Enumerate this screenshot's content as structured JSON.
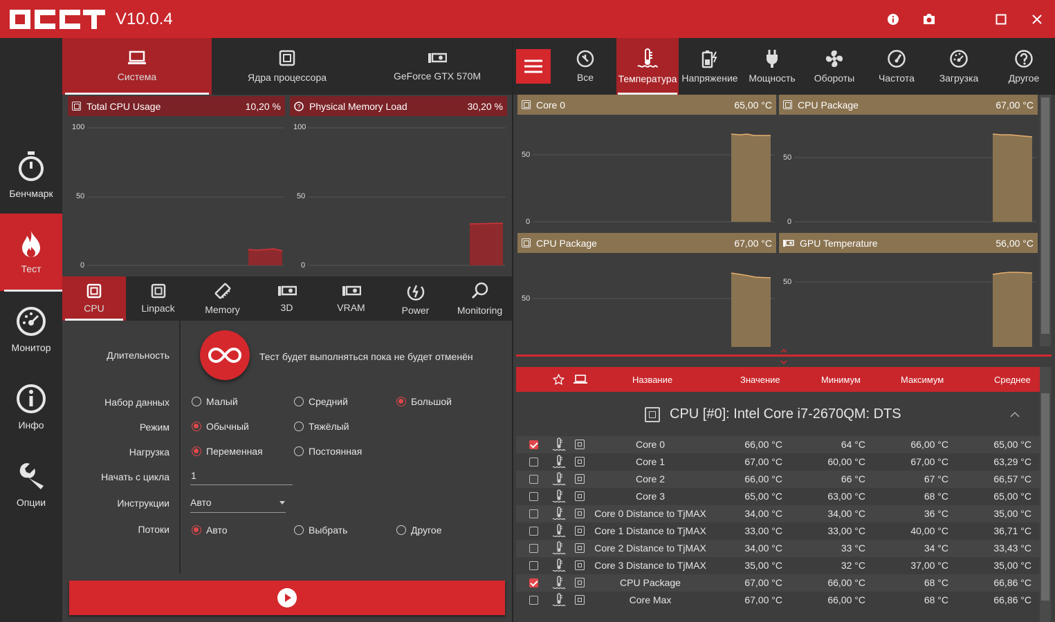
{
  "app": {
    "title": "OCCT",
    "version": "V10.0.4"
  },
  "window_buttons": {
    "info": "info-icon",
    "screenshot": "camera-icon",
    "maximize": "maximize-icon",
    "close": "close-icon"
  },
  "colors": {
    "accent": "#c8262b",
    "dark": "#2a2a2a",
    "panel": "#3d3d3d",
    "tan": "#8a7350"
  },
  "leftnav": [
    {
      "label": "Бенчмарк",
      "icon": "stopwatch-icon"
    },
    {
      "label": "Тест",
      "icon": "flame-icon"
    },
    {
      "label": "Монитор",
      "icon": "gauge-icon"
    },
    {
      "label": "Инфо",
      "icon": "info-icon"
    },
    {
      "label": "Опции",
      "icon": "wrench-icon"
    }
  ],
  "system_tabs": [
    {
      "label": "Система",
      "icon": "laptop-icon"
    },
    {
      "label": "Ядра процессора",
      "icon": "cpu-icon"
    },
    {
      "label": "GeForce GTX 570M",
      "icon": "gpu-icon"
    }
  ],
  "left_graphs": [
    {
      "title": "Total CPU Usage",
      "value": "10,20 %",
      "ticks": [
        "100",
        "50",
        "0"
      ]
    },
    {
      "title": "Physical Memory Load",
      "value": "30,20 %",
      "ticks": [
        "100",
        "50",
        "0"
      ]
    }
  ],
  "test_tabs": [
    {
      "label": "CPU",
      "icon": "cpu-icon"
    },
    {
      "label": "Linpack",
      "icon": "cpu-icon"
    },
    {
      "label": "Memory",
      "icon": "memory-icon"
    },
    {
      "label": "3D",
      "icon": "gpu-icon"
    },
    {
      "label": "VRAM",
      "icon": "gpu-icon"
    },
    {
      "label": "Power",
      "icon": "power-icon"
    },
    {
      "label": "Monitoring",
      "icon": "magnifier-icon"
    }
  ],
  "settings": {
    "duration_label": "Длительность",
    "duration_text": "Тест будет выполняться пока не будет отменён",
    "dataset_label": "Набор данных",
    "dataset_options": [
      "Малый",
      "Средний",
      "Большой"
    ],
    "mode_label": "Режим",
    "mode_options": [
      "Обычный",
      "Тяжёлый"
    ],
    "load_label": "Нагрузка",
    "load_options": [
      "Переменная",
      "Постоянная"
    ],
    "start_cycle_label": "Начать с цикла",
    "start_cycle_value": "1",
    "instructions_label": "Инструкции",
    "instructions_value": "Авто",
    "threads_label": "Потоки",
    "threads_options": [
      "Авто",
      "Выбрать",
      "Другое"
    ]
  },
  "right_tabs": [
    {
      "label": "",
      "icon": "hamburger-icon"
    },
    {
      "label": "Все",
      "icon": "all-icon"
    },
    {
      "label": "Температура",
      "icon": "thermometer-icon"
    },
    {
      "label": "Напряжение",
      "icon": "battery-icon"
    },
    {
      "label": "Мощность",
      "icon": "plug-icon"
    },
    {
      "label": "Обороты",
      "icon": "fan-icon"
    },
    {
      "label": "Частота",
      "icon": "speedometer-icon"
    },
    {
      "label": "Загрузка",
      "icon": "gauge-icon"
    },
    {
      "label": "Другое",
      "icon": "question-icon"
    }
  ],
  "right_graphs": [
    {
      "title": "Core 0",
      "value": "65,00 °C",
      "ticks": [
        "50",
        "0"
      ]
    },
    {
      "title": "CPU Package",
      "value": "67,00 °C",
      "ticks": [
        "50",
        "0"
      ]
    },
    {
      "title": "CPU Package",
      "value": "67,00 °C",
      "ticks": [
        "50"
      ]
    },
    {
      "title": "GPU Temperature",
      "value": "56,00 °C",
      "ticks": [
        "50"
      ]
    }
  ],
  "table": {
    "headers": [
      "Название",
      "Значение",
      "Минимум",
      "Максимум",
      "Среднее"
    ],
    "group_title": "CPU [#0]: Intel Core i7-2670QM: DTS",
    "rows": [
      {
        "name": "Core 0",
        "value": "66,00 °C",
        "min": "64 °C",
        "max": "66,00 °C",
        "avg": "65,00 °C",
        "checked": true
      },
      {
        "name": "Core 1",
        "value": "67,00 °C",
        "min": "60,00 °C",
        "max": "67,00 °C",
        "avg": "63,29 °C",
        "checked": false
      },
      {
        "name": "Core 2",
        "value": "66,00 °C",
        "min": "66 °C",
        "max": "67 °C",
        "avg": "66,57 °C",
        "checked": false
      },
      {
        "name": "Core 3",
        "value": "65,00 °C",
        "min": "63,00 °C",
        "max": "68 °C",
        "avg": "65,00 °C",
        "checked": false
      },
      {
        "name": "Core 0 Distance to TjMAX",
        "value": "34,00 °C",
        "min": "34,00 °C",
        "max": "36 °C",
        "avg": "35,00 °C",
        "checked": false
      },
      {
        "name": "Core 1 Distance to TjMAX",
        "value": "33,00 °C",
        "min": "33,00 °C",
        "max": "40,00 °C",
        "avg": "36,71 °C",
        "checked": false
      },
      {
        "name": "Core 2 Distance to TjMAX",
        "value": "34,00 °C",
        "min": "33 °C",
        "max": "34 °C",
        "avg": "33,43 °C",
        "checked": false
      },
      {
        "name": "Core 3 Distance to TjMAX",
        "value": "35,00 °C",
        "min": "32 °C",
        "max": "37,00 °C",
        "avg": "35,00 °C",
        "checked": false
      },
      {
        "name": "CPU Package",
        "value": "67,00 °C",
        "min": "66,00 °C",
        "max": "68 °C",
        "avg": "66,86 °C",
        "checked": true
      },
      {
        "name": "Core Max",
        "value": "67,00 °C",
        "min": "66,00 °C",
        "max": "68 °C",
        "avg": "66,86 °C",
        "checked": false
      }
    ]
  }
}
